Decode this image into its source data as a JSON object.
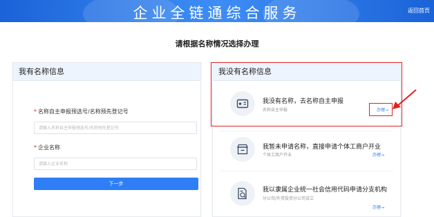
{
  "header": {
    "title": "企业全链通综合服务",
    "home_link": "返回首页"
  },
  "subtitle": "请根据名称情况选择办理",
  "left_panel": {
    "title": "我有名称信息",
    "field1": {
      "label": "名称自主申报预选号/名称预先登记号",
      "placeholder": "请输入名称自主申报预选号/名称预先登记号"
    },
    "field2": {
      "label": "企业名称",
      "placeholder": "请输入企业名称"
    },
    "next_button": "下一步"
  },
  "right_panel": {
    "title": "我没有名称信息",
    "options": [
      {
        "title": "我没有名称，去名称自主申报",
        "subtitle": "名称自主申报",
        "link": "办理→",
        "icon": "id-card-icon"
      },
      {
        "title": "我暂未申请名称，直接申请个体工商户开业",
        "subtitle": "个体工商户开业",
        "link": "办理→",
        "icon": "storefront-icon"
      },
      {
        "title": "我以隶属企业统一社会信用代码申请分支机构",
        "subtitle": "分公司/外资投资分公司设立",
        "link": "办理→",
        "icon": "document-edit-icon"
      }
    ]
  },
  "colors": {
    "header_blue": "#2f7ef5",
    "annotation_red": "#e02020"
  }
}
